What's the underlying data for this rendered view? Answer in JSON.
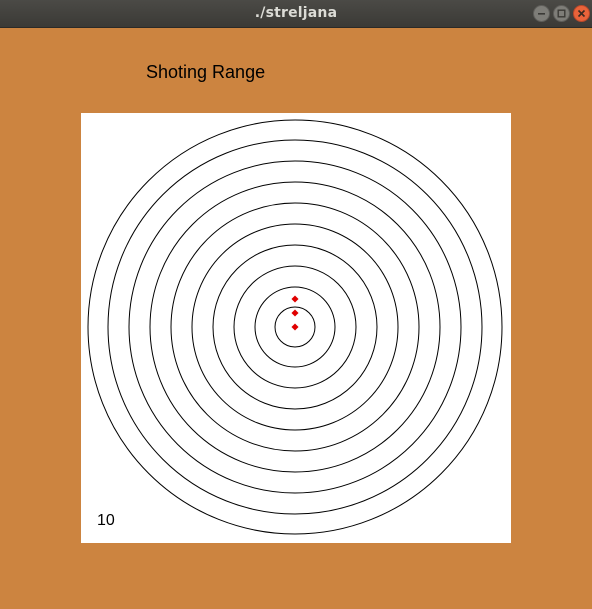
{
  "window": {
    "title": "./streljana",
    "controls": [
      "minimize-icon",
      "maximize-icon",
      "close-icon"
    ],
    "close_color": "#e9633a"
  },
  "app": {
    "heading": "Shoting Range",
    "score": "10",
    "background_color": "#cc8440",
    "target_background": "#ffffff",
    "ring_count": 10,
    "hit_color": "#e00000",
    "hits": [
      {
        "label": "shot-1"
      },
      {
        "label": "shot-2"
      },
      {
        "label": "shot-3"
      }
    ]
  }
}
